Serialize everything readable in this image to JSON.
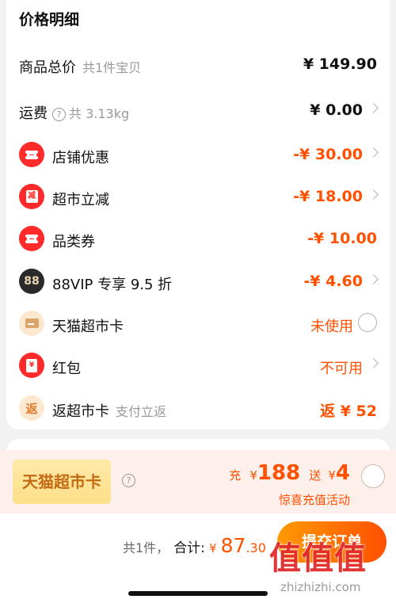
{
  "section_title": "价格明细",
  "rows": [
    {
      "label": "商品总价",
      "sub": "共1件宝贝",
      "value": "¥ 149.90"
    },
    {
      "label": "运费",
      "sub": "共 3.13kg",
      "value": "¥ 0.00"
    },
    {
      "label": "店铺优惠",
      "value": "-¥ 30.00"
    },
    {
      "label": "超市立减",
      "icon_text": "减",
      "value": "-¥ 18.00"
    },
    {
      "label": "品类券",
      "value": "-¥ 10.00"
    },
    {
      "label": "88VIP 专享 9.5 折",
      "icon_text": "88",
      "value": "-¥ 4.60"
    },
    {
      "label": "天猫超市卡",
      "value": "未使用"
    },
    {
      "label": "红包",
      "icon_text": "¥",
      "value": "不可用"
    },
    {
      "label": "返超市卡",
      "icon_text": "返",
      "sub": "支付立返",
      "value": "返 ¥ 52"
    }
  ],
  "promo": {
    "badge": "天猫超市卡",
    "charge_label": "充",
    "charge_currency": "¥",
    "charge_amount": "188",
    "gift_label": "送",
    "gift_currency": "¥",
    "gift_amount": "4",
    "subtitle": "惊喜充值活动"
  },
  "footer": {
    "count": "共1件，",
    "total_label": "合计:",
    "currency": "¥",
    "amount_int": "87",
    "amount_dec": ".30",
    "submit_label": "提交订单"
  },
  "watermark": {
    "logo": "值值值",
    "url": "zhizhizhi.com"
  },
  "colors": {
    "accent": "#ff5000",
    "discount_icon": "#ff2a2a",
    "promo_bg": "#fdf0ea"
  }
}
